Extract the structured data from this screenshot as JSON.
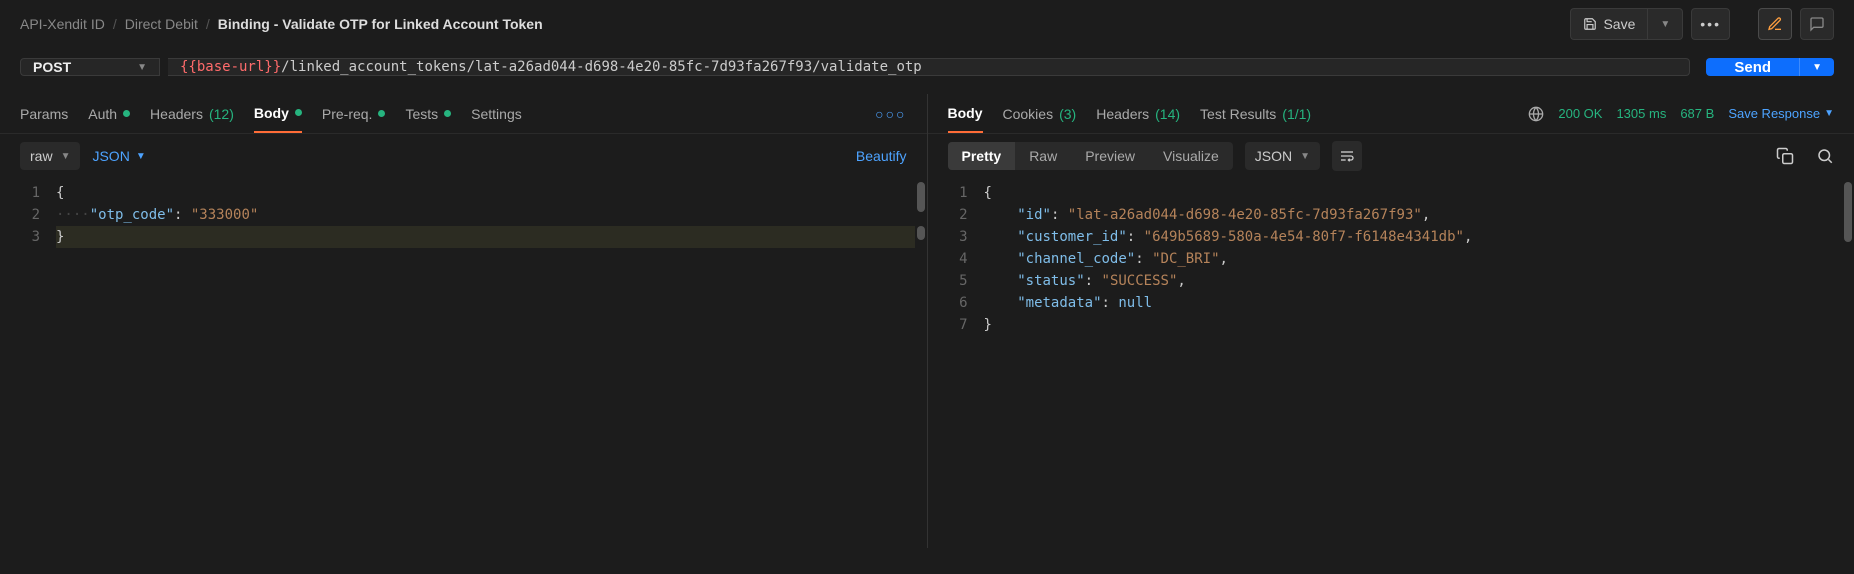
{
  "breadcrumbs": {
    "a": "API-Xendit ID",
    "b": "Direct Debit",
    "c": "Binding - Validate OTP for Linked Account Token"
  },
  "topbar": {
    "save": "Save"
  },
  "request": {
    "method": "POST",
    "url_var": "{{base-url}}",
    "url_path": "/linked_account_tokens/lat-a26ad044-d698-4e20-85fc-7d93fa267f93/validate_otp",
    "send": "Send"
  },
  "req_tabs": {
    "params": "Params",
    "auth": "Auth",
    "headers": "Headers",
    "headers_count": "(12)",
    "body": "Body",
    "prereq": "Pre-req.",
    "tests": "Tests",
    "settings": "Settings"
  },
  "req_sub": {
    "raw": "raw",
    "lang": "JSON",
    "beautify": "Beautify"
  },
  "req_body_lines": [
    {
      "n": "1",
      "html": "<span class='tok-punc'>{</span>"
    },
    {
      "n": "2",
      "html": "<span class='indent-dots'>····</span><span class='tok-key'>\"otp_code\"</span><span class='tok-punc'>: </span><span class='tok-str'>\"333000\"</span>"
    },
    {
      "n": "3",
      "html": "<span class='tok-punc'>}</span>"
    }
  ],
  "resp_tabs": {
    "body": "Body",
    "cookies": "Cookies",
    "cookies_count": "(3)",
    "headers": "Headers",
    "headers_count": "(14)",
    "tests": "Test Results",
    "tests_count": "(1/1)"
  },
  "resp_meta": {
    "status": "200 OK",
    "time": "1305 ms",
    "size": "687 B",
    "save": "Save Response"
  },
  "resp_sub": {
    "pretty": "Pretty",
    "raw": "Raw",
    "preview": "Preview",
    "visualize": "Visualize",
    "lang": "JSON"
  },
  "resp_body_lines": [
    {
      "n": "1",
      "html": "<span class='tok-punc'>{</span>"
    },
    {
      "n": "2",
      "html": "    <span class='tok-key'>\"id\"</span><span class='tok-punc'>: </span><span class='tok-str'>\"lat-a26ad044-d698-4e20-85fc-7d93fa267f93\"</span><span class='tok-punc'>,</span>"
    },
    {
      "n": "3",
      "html": "    <span class='tok-key'>\"customer_id\"</span><span class='tok-punc'>: </span><span class='tok-str'>\"649b5689-580a-4e54-80f7-f6148e4341db\"</span><span class='tok-punc'>,</span>"
    },
    {
      "n": "4",
      "html": "    <span class='tok-key'>\"channel_code\"</span><span class='tok-punc'>: </span><span class='tok-str'>\"DC_BRI\"</span><span class='tok-punc'>,</span>"
    },
    {
      "n": "5",
      "html": "    <span class='tok-key'>\"status\"</span><span class='tok-punc'>: </span><span class='tok-str'>\"SUCCESS\"</span><span class='tok-punc'>,</span>"
    },
    {
      "n": "6",
      "html": "    <span class='tok-key'>\"metadata\"</span><span class='tok-punc'>: </span><span class='tok-null'>null</span>"
    },
    {
      "n": "7",
      "html": "<span class='tok-punc'>}</span>"
    }
  ]
}
